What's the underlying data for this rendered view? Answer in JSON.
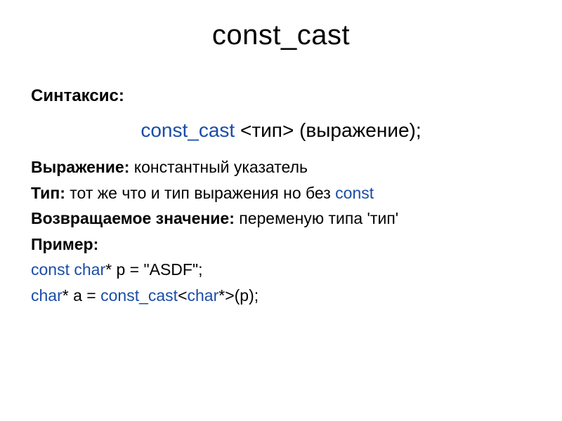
{
  "title": "const_cast",
  "syntax_label": "Синтаксис:",
  "syntax": {
    "keyword": "const_cast",
    "template": " <тип> (выражение);"
  },
  "lines": {
    "expr_label": "Выражение:",
    "expr_text": " константный указатель",
    "type_label": "Тип:",
    "type_text_1": " тот же что и тип выражения но без ",
    "type_keyword": "const",
    "return_label": "Возвращаемое значение:",
    "return_text": "   переменую типа 'тип'",
    "example_label": "Пример:",
    "ex1_keyword": "const char",
    "ex1_rest": "* p = \"ASDF\";",
    "ex2_keyword1": "char",
    "ex2_mid": "* a = ",
    "ex2_keyword2": "const_cast",
    "ex2_tmpl_open": "<",
    "ex2_keyword3": "char",
    "ex2_tmpl_close": "*>(p);"
  }
}
